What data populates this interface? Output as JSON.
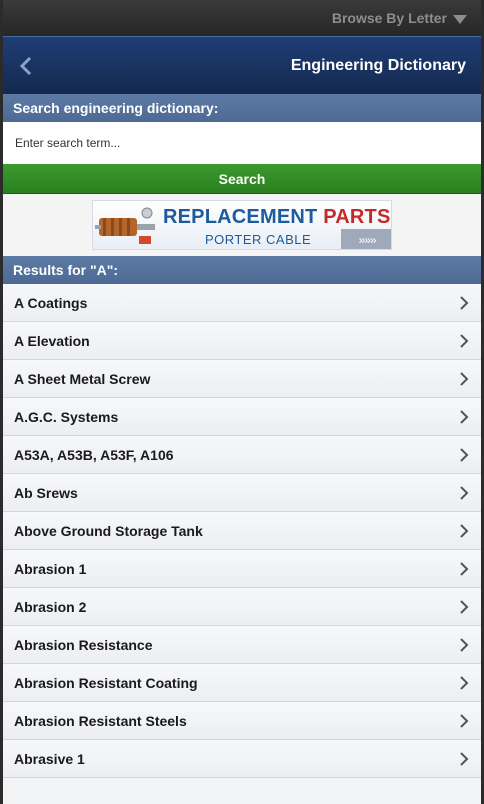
{
  "topbar": {
    "browse_label": "Browse By Letter"
  },
  "header": {
    "title": "Engineering Dictionary"
  },
  "search": {
    "section_label": "Search engineering dictionary:",
    "placeholder": "Enter search term...",
    "button_label": "Search"
  },
  "ad": {
    "title_part1": "REPLACEMENT ",
    "title_part2": "PARTS",
    "subtitle": "PORTER CABLE",
    "arrows": "»»»"
  },
  "results": {
    "header": "Results for \"A\":",
    "items": [
      "A Coatings",
      "A Elevation",
      "A Sheet Metal Screw",
      "A.G.C. Systems",
      "A53A, A53B, A53F, A106",
      "Ab Srews",
      "Above Ground Storage Tank",
      "Abrasion 1",
      "Abrasion 2",
      "Abrasion Resistance",
      "Abrasion Resistant Coating",
      "Abrasion Resistant Steels",
      "Abrasive 1"
    ]
  },
  "icons": {
    "back": "chevron-left-icon",
    "dropdown": "triangle-down-icon",
    "row": "chevron-right-icon"
  },
  "colors": {
    "header_bg": "#1f3d75",
    "section_bg": "#5d7aa5",
    "search_button": "#3c9a2e"
  }
}
